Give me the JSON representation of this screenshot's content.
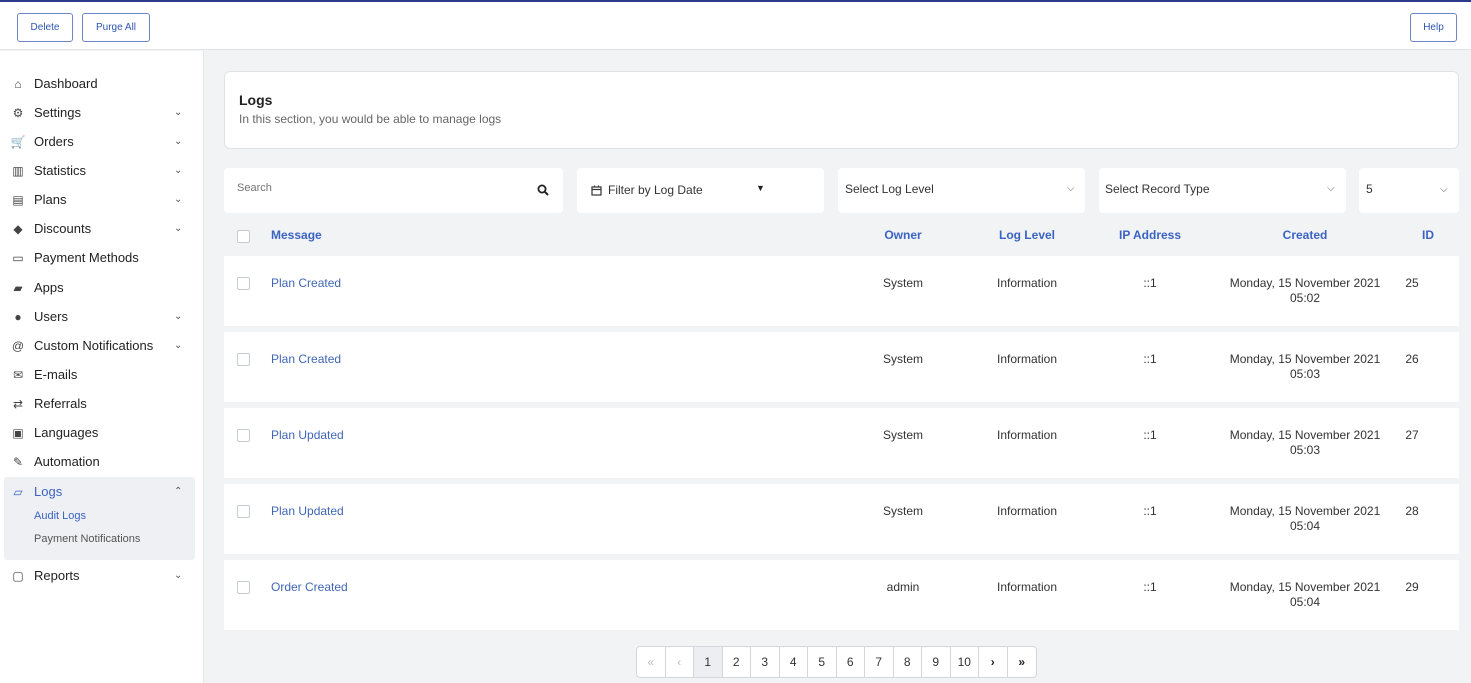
{
  "toolbar": {
    "delete_label": "Delete",
    "purge_label": "Purge All",
    "help_label": "Help"
  },
  "sidebar": {
    "items": [
      {
        "label": "Dashboard",
        "icon": "home-icon",
        "expandable": false
      },
      {
        "label": "Settings",
        "icon": "gear-icon",
        "expandable": true
      },
      {
        "label": "Orders",
        "icon": "cart-icon",
        "expandable": true
      },
      {
        "label": "Statistics",
        "icon": "bar-chart-icon",
        "expandable": true
      },
      {
        "label": "Plans",
        "icon": "plans-icon",
        "expandable": true
      },
      {
        "label": "Discounts",
        "icon": "tags-icon",
        "expandable": true
      },
      {
        "label": "Payment Methods",
        "icon": "credit-card-icon",
        "expandable": false
      },
      {
        "label": "Apps",
        "icon": "apps-icon",
        "expandable": false
      },
      {
        "label": "Users",
        "icon": "user-icon",
        "expandable": true
      },
      {
        "label": "Custom Notifications",
        "icon": "at-icon",
        "expandable": true
      },
      {
        "label": "E-mails",
        "icon": "envelope-icon",
        "expandable": false
      },
      {
        "label": "Referrals",
        "icon": "retweet-icon",
        "expandable": false
      },
      {
        "label": "Languages",
        "icon": "language-icon",
        "expandable": false
      },
      {
        "label": "Automation",
        "icon": "magic-wand-icon",
        "expandable": false
      },
      {
        "label": "Logs",
        "icon": "folder-open-icon",
        "expandable": true,
        "expanded": true
      },
      {
        "label": "Reports",
        "icon": "report-file-icon",
        "expandable": true
      }
    ],
    "logs_sub": [
      "Audit Logs",
      "Payment Notifications"
    ]
  },
  "header": {
    "title": "Logs",
    "subtitle": "In this section, you would be able to manage logs"
  },
  "filters": {
    "search_placeholder": "Search",
    "date_filter_label": "Filter by Log Date",
    "log_level_label": "Select Log Level",
    "record_type_label": "Select Record Type",
    "page_size": "5"
  },
  "table": {
    "headers": [
      "Message",
      "Owner",
      "Log Level",
      "IP Address",
      "Created",
      "ID"
    ],
    "rows": [
      {
        "message": "Plan Created",
        "owner": "System",
        "level": "Information",
        "ip": "::1",
        "date": "Monday, 15 November 2021",
        "time": "05:02",
        "id": "25"
      },
      {
        "message": "Plan Created",
        "owner": "System",
        "level": "Information",
        "ip": "::1",
        "date": "Monday, 15 November 2021",
        "time": "05:03",
        "id": "26"
      },
      {
        "message": "Plan Updated",
        "owner": "System",
        "level": "Information",
        "ip": "::1",
        "date": "Monday, 15 November 2021",
        "time": "05:03",
        "id": "27"
      },
      {
        "message": "Plan Updated",
        "owner": "System",
        "level": "Information",
        "ip": "::1",
        "date": "Monday, 15 November 2021",
        "time": "05:04",
        "id": "28"
      },
      {
        "message": "Order Created",
        "owner": "admin",
        "level": "Information",
        "ip": "::1",
        "date": "Monday, 15 November 2021",
        "time": "05:04",
        "id": "29"
      }
    ]
  },
  "pagination": {
    "first": "«",
    "prev": "‹",
    "pages": [
      "1",
      "2",
      "3",
      "4",
      "5",
      "6",
      "7",
      "8",
      "9",
      "10"
    ],
    "current": "1",
    "next": "›",
    "last": "»"
  },
  "colors": {
    "accent": "#3a63c3",
    "link": "#3f66b5",
    "topbar_border": "#2b3a8a",
    "background": "#f2f3f5"
  }
}
